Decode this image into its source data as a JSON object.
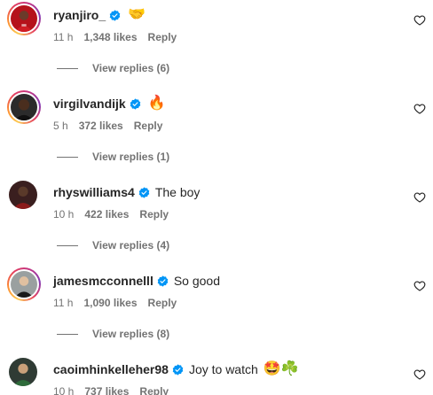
{
  "colors": {
    "text": "#262626",
    "secondary": "#737373",
    "verified": "#0095f6",
    "background": "#ffffff"
  },
  "comments": [
    {
      "username": "ryanjiro_",
      "text": "",
      "emoji": "🤝",
      "time": "11 h",
      "likes": "1,348 likes",
      "reply": "Reply",
      "replies": "View replies (6)",
      "avatar_story": true
    },
    {
      "username": "virgilvandijk",
      "text": "",
      "emoji": "🔥",
      "time": "5 h",
      "likes": "372 likes",
      "reply": "Reply",
      "replies": "View replies (1)",
      "avatar_story": true
    },
    {
      "username": "rhyswilliams4",
      "text": "The boy",
      "emoji": "",
      "time": "10 h",
      "likes": "422 likes",
      "reply": "Reply",
      "replies": "View replies (4)",
      "avatar_story": false
    },
    {
      "username": "jamesmcconnelll",
      "text": "So good",
      "emoji": "",
      "time": "11 h",
      "likes": "1,090 likes",
      "reply": "Reply",
      "replies": "View replies (8)",
      "avatar_story": true
    },
    {
      "username": "caoimhinkelleher98",
      "text": "Joy to watch",
      "emoji": "🤩☘️",
      "time": "10 h",
      "likes": "737 likes",
      "reply": "Reply",
      "replies": "",
      "avatar_story": false
    }
  ],
  "icons": {
    "heart": "heart-outline-icon",
    "verified": "verified-badge-icon"
  }
}
